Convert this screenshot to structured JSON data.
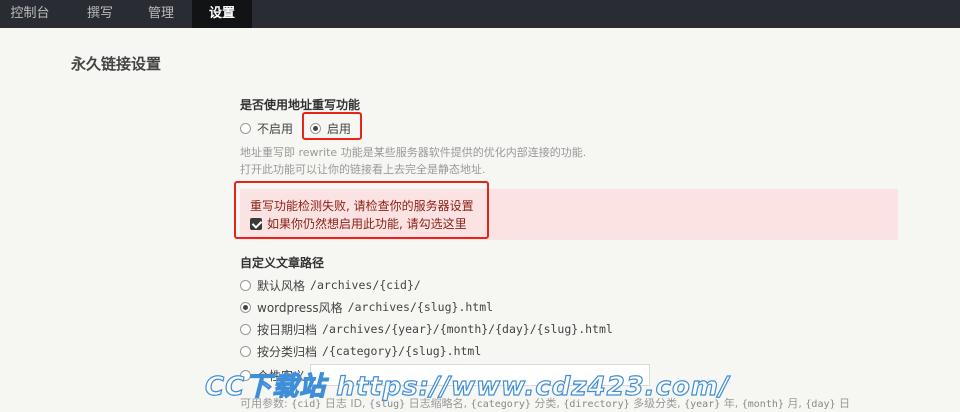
{
  "nav": {
    "tabs": [
      {
        "label": "控制台"
      },
      {
        "label": "撰写"
      },
      {
        "label": "管理"
      },
      {
        "label": "设置",
        "active": true
      }
    ]
  },
  "page": {
    "title": "永久链接设置"
  },
  "rewrite": {
    "title": "是否使用地址重写功能",
    "options": [
      {
        "label": "不启用",
        "checked": false
      },
      {
        "label": "启用",
        "checked": true
      }
    ],
    "desc_line1": "地址重写即 rewrite 功能是某些服务器软件提供的优化内部连接的功能.",
    "desc_line2": "打开此功能可以让你的链接看上去完全是静态地址."
  },
  "warning": {
    "message": "重写功能检测失败, 请检查你的服务器设置",
    "checkbox_label": "如果你仍然想启用此功能, 请勾选这里",
    "checked": true
  },
  "post_path": {
    "title": "自定义文章路径",
    "options": [
      {
        "label": "默认风格",
        "pattern": "/archives/{cid}/",
        "checked": false
      },
      {
        "label": "wordpress风格",
        "pattern": "/archives/{slug}.html",
        "checked": true
      },
      {
        "label": "按日期归档",
        "pattern": "/archives/{year}/{month}/{day}/{slug}.html",
        "checked": false
      },
      {
        "label": "按分类归档",
        "pattern": "/{category}/{slug}.html",
        "checked": false
      },
      {
        "label": "个性定义",
        "pattern": "",
        "checked": false
      }
    ],
    "params_prefix": "可用参数:",
    "params": [
      {
        "code": "{cid}",
        "text": "日志 ID,"
      },
      {
        "code": "{slug}",
        "text": "日志缩略名,"
      },
      {
        "code": "{category}",
        "text": "分类,"
      },
      {
        "code": "{directory}",
        "text": "多级分类,"
      },
      {
        "code": "{year}",
        "text": "年,"
      },
      {
        "code": "{month}",
        "text": "月,"
      },
      {
        "code": "{day}",
        "text": "日"
      }
    ]
  },
  "watermark": {
    "text": "CC下载站 https://www.cdz423.com/"
  },
  "colors": {
    "nav_bg": "#292d33",
    "nav_active_bg": "#111315",
    "page_bg": "#f6f6f3",
    "warning_bg": "#fbe3e4",
    "warning_text": "#8a1f11",
    "highlight_border": "#e8231a",
    "watermark": "#3f8ed8"
  }
}
